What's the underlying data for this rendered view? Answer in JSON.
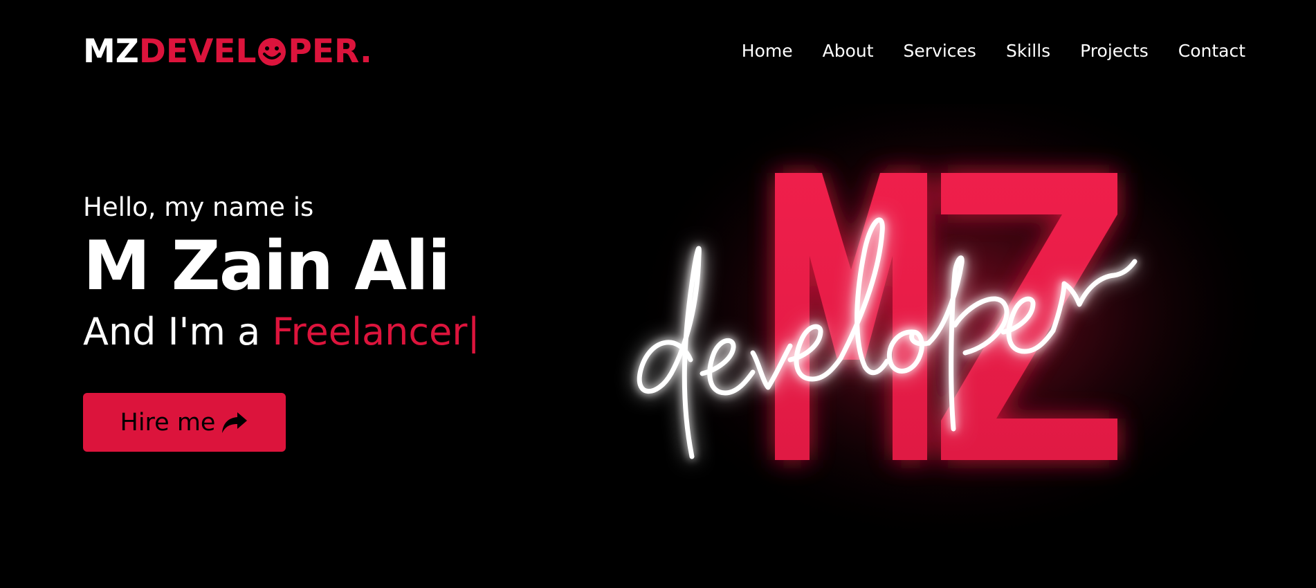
{
  "logo": {
    "part1": "MZ",
    "part2": "DEVEL",
    "part3": "PER.",
    "icon": "smiley-face-icon"
  },
  "nav": {
    "items": [
      {
        "label": "Home"
      },
      {
        "label": "About"
      },
      {
        "label": "Services"
      },
      {
        "label": "Skills"
      },
      {
        "label": "Projects"
      },
      {
        "label": "Contact"
      }
    ]
  },
  "hero": {
    "greeting": "Hello, my name is",
    "name": "M Zain Ali",
    "role_prefix": "And I'm a ",
    "role": "Freelancer",
    "cursor": "|",
    "button_label": "Hire me",
    "button_icon": "share-arrow-icon"
  },
  "artwork": {
    "big_letters": "MZ",
    "script_word": "developer"
  },
  "colors": {
    "background": "#000000",
    "accent": "#dc143c",
    "text": "#ffffff"
  }
}
